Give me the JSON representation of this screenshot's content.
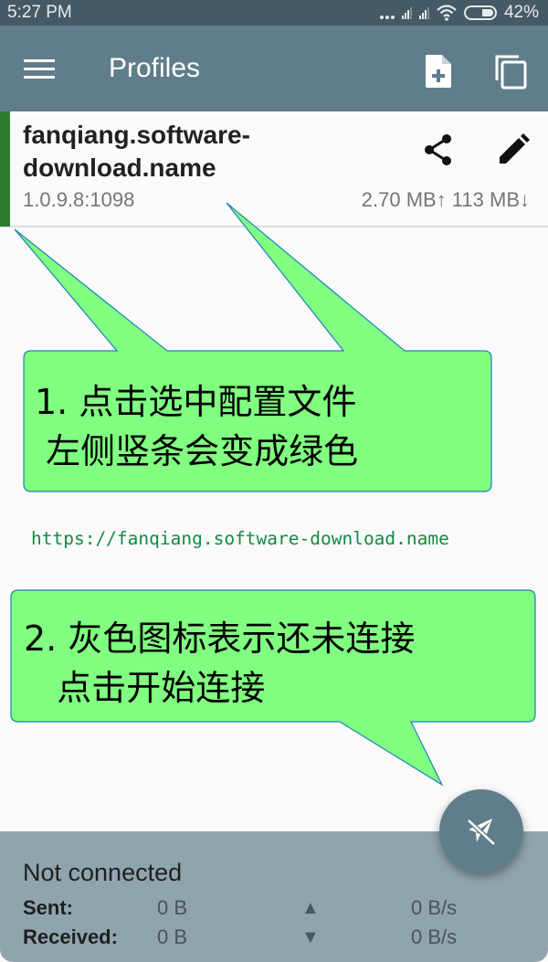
{
  "status_bar": {
    "time": "5:27 PM",
    "battery": "42%",
    "icons": [
      "more-dots-icon",
      "signal-icon",
      "signal-icon",
      "wifi-icon",
      "battery-icon"
    ]
  },
  "app_bar": {
    "title": "Profiles",
    "icons": {
      "menu": "menu-icon",
      "add": "add-file-icon",
      "copy": "copy-icon"
    }
  },
  "profile": {
    "name": "fanqiang.software-download.name",
    "host": "1.0.9.8:1098",
    "traffic": "2.70 MB↑ 113 MB↓",
    "selected": true,
    "stripe_color": "#2e7d32",
    "icons": {
      "share": "share-icon",
      "edit": "edit-icon"
    }
  },
  "annotations": {
    "callout_1": "1. 点击选中配置文件\n 左侧竖条会变成绿色",
    "callout_2": "2. 灰色图标表示还未连接\n   点击开始连接",
    "url": "https://fanqiang.software-download.name",
    "callout_fill": "#80ff80",
    "callout_stroke": "#1e7fbf"
  },
  "connection": {
    "state": "Not connected",
    "sent_label": "Sent:",
    "sent_total": "0 B",
    "sent_rate": "0 B/s",
    "received_label": "Received:",
    "received_total": "0 B",
    "received_rate": "0 B/s",
    "up_arrow": "▲",
    "down_arrow": "▼"
  },
  "fab": {
    "icon": "airplane-off-icon",
    "state": "disconnected"
  },
  "colors": {
    "status_bar": "#455a64",
    "app_bar": "#607d8b",
    "panel": "#90a4ae",
    "url": "#138a45"
  }
}
